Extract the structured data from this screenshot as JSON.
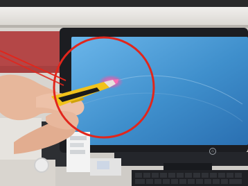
{
  "scene": {
    "description_tags": [
      "office-shelf",
      "monitor",
      "hand",
      "voltage-tester-pen",
      "keyboard",
      "red-annotation-circle"
    ],
    "colors": {
      "wall": "#d7d4cf",
      "shelf": "#e8e5e0",
      "red_cabinet": "#b64a4a",
      "monitor_bezel": "#1c1d21",
      "screen_top": "#5aa6dc",
      "screen_bottom": "#2b77b8",
      "skin": "#e8b59a",
      "pen_body": "#f1c21b",
      "pen_tip": "#e7e2dd",
      "tip_glow": "#ff5aa8",
      "annotation": "#e1261c",
      "keyboard": "#1f2024",
      "keycap": "#2d2f34",
      "papers": "#f2f2f2"
    }
  }
}
